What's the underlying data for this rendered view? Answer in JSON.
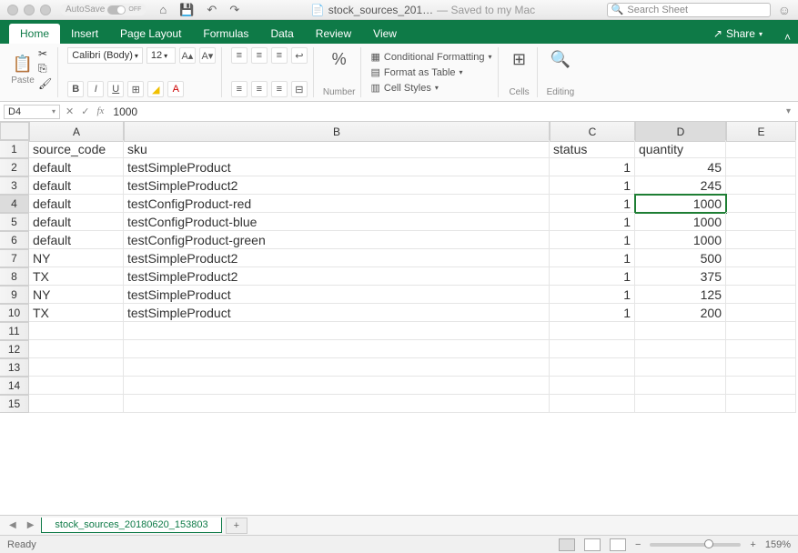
{
  "title_bar": {
    "autosave_text": "AutoSave",
    "autosave_state": "OFF",
    "doc_name": "stock_sources_201…",
    "saved_status": "— Saved to my Mac",
    "search_placeholder": "Search Sheet"
  },
  "menu": {
    "tabs": [
      "Home",
      "Insert",
      "Page Layout",
      "Formulas",
      "Data",
      "Review",
      "View"
    ],
    "share": "Share"
  },
  "ribbon": {
    "paste": "Paste",
    "font_name": "Calibri (Body)",
    "font_size": "12",
    "number_label": "Number",
    "cond_fmt": "Conditional Formatting",
    "fmt_table": "Format as Table",
    "cell_styles": "Cell Styles",
    "cells": "Cells",
    "editing": "Editing"
  },
  "formula_bar": {
    "name_box": "D4",
    "formula": "1000"
  },
  "grid": {
    "columns": [
      "A",
      "B",
      "C",
      "D",
      "E"
    ],
    "active_col": "D",
    "active_row": 4,
    "rows": [
      {
        "A": "source_code",
        "B": "sku",
        "C": "status",
        "D": "quantity",
        "E": ""
      },
      {
        "A": "default",
        "B": "testSimpleProduct",
        "C": "1",
        "D": "45",
        "E": ""
      },
      {
        "A": "default",
        "B": "testSimpleProduct2",
        "C": "1",
        "D": "245",
        "E": ""
      },
      {
        "A": "default",
        "B": "testConfigProduct-red",
        "C": "1",
        "D": "1000",
        "E": ""
      },
      {
        "A": "default",
        "B": "testConfigProduct-blue",
        "C": "1",
        "D": "1000",
        "E": ""
      },
      {
        "A": "default",
        "B": "testConfigProduct-green",
        "C": "1",
        "D": "1000",
        "E": ""
      },
      {
        "A": "NY",
        "B": "testSimpleProduct2",
        "C": "1",
        "D": "500",
        "E": ""
      },
      {
        "A": "TX",
        "B": "testSimpleProduct2",
        "C": "1",
        "D": "375",
        "E": ""
      },
      {
        "A": "NY",
        "B": "testSimpleProduct",
        "C": "1",
        "D": "125",
        "E": ""
      },
      {
        "A": "TX",
        "B": "testSimpleProduct",
        "C": "1",
        "D": "200",
        "E": ""
      },
      {
        "A": "",
        "B": "",
        "C": "",
        "D": "",
        "E": ""
      },
      {
        "A": "",
        "B": "",
        "C": "",
        "D": "",
        "E": ""
      },
      {
        "A": "",
        "B": "",
        "C": "",
        "D": "",
        "E": ""
      },
      {
        "A": "",
        "B": "",
        "C": "",
        "D": "",
        "E": ""
      },
      {
        "A": "",
        "B": "",
        "C": "",
        "D": "",
        "E": ""
      }
    ],
    "total_rows": 15
  },
  "sheet_tabs": {
    "active": "stock_sources_20180620_153803"
  },
  "status": {
    "ready": "Ready",
    "zoom": "159%"
  }
}
